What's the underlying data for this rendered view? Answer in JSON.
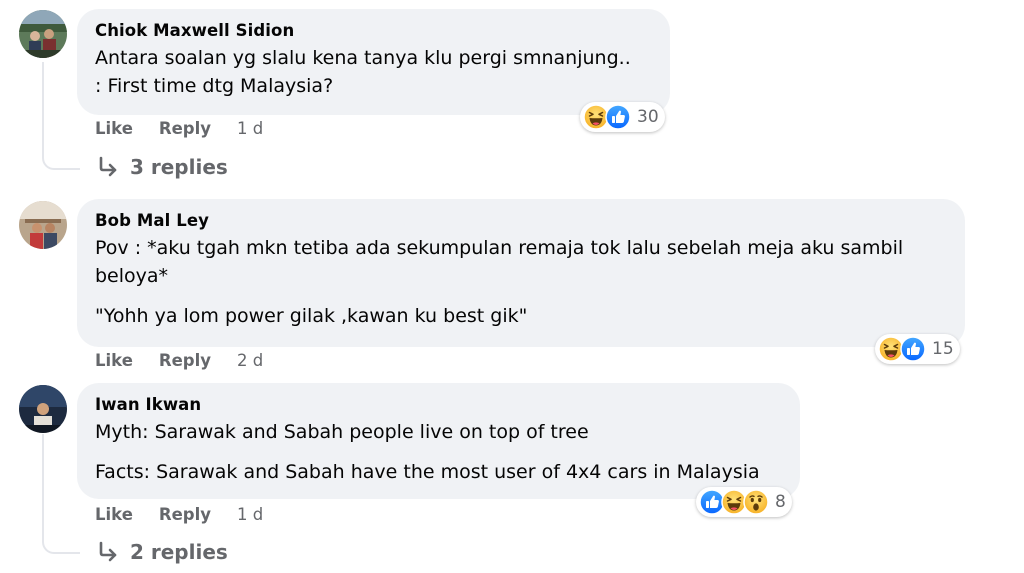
{
  "comments": [
    {
      "author": "Chiok Maxwell Sidion",
      "lines": [
        "Antara soalan yg slalu kena tanya klu pergi smnanjung..",
        ": First time dtg Malaysia?"
      ],
      "reaction_count": "30",
      "reaction_icons": [
        "haha-icon",
        "like-icon"
      ],
      "like_label": "Like",
      "reply_label": "Reply",
      "time": "1 d",
      "replies_label": "3 replies"
    },
    {
      "author": "Bob Mal Ley",
      "lines": [
        "Pov : *aku tgah mkn tetiba ada sekumpulan remaja tok lalu sebelah meja aku sambil beloya*",
        "\"Yohh ya lom power gilak ,kawan ku best gik\""
      ],
      "reaction_count": "15",
      "reaction_icons": [
        "haha-icon",
        "like-icon"
      ],
      "like_label": "Like",
      "reply_label": "Reply",
      "time": "2 d"
    },
    {
      "author": "Iwan Ikwan",
      "lines": [
        "Myth: Sarawak and Sabah people live on top of tree",
        "Facts: Sarawak and Sabah have the most user of 4x4 cars in Malaysia"
      ],
      "reaction_count": "8",
      "reaction_icons": [
        "like-icon",
        "haha-icon",
        "wow-icon"
      ],
      "like_label": "Like",
      "reply_label": "Reply",
      "time": "1 d",
      "replies_label": "2 replies"
    }
  ],
  "colors": {
    "bubble": "#f0f2f5",
    "secondary_text": "#65676b",
    "like_blue": "#1877f2",
    "reaction_yellow": "#f7b125"
  }
}
